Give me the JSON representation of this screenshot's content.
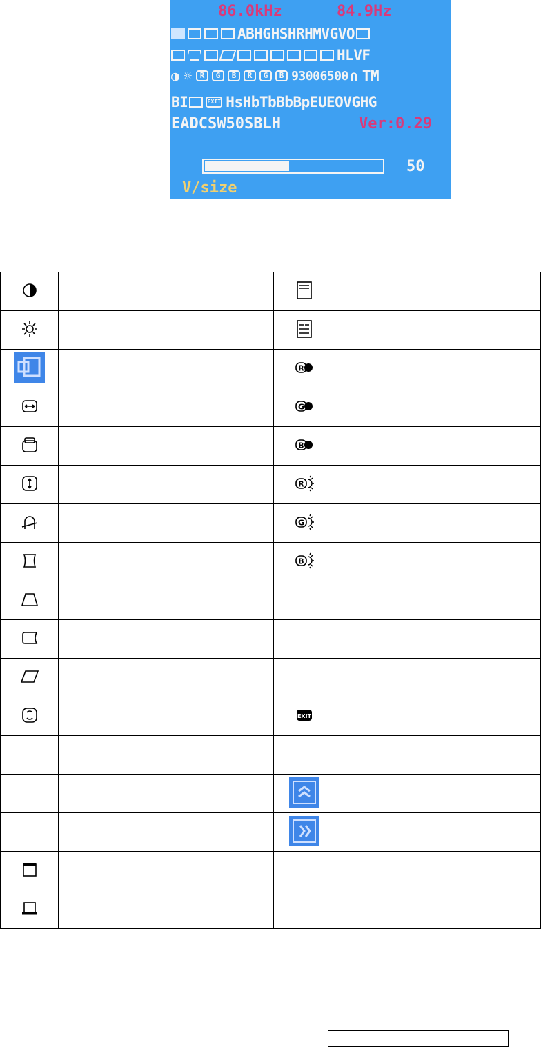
{
  "osd": {
    "h_freq": "86.0kHz",
    "v_freq": "84.9Hz",
    "line1_text": "ABHGHSHRHMVGVO",
    "line2_text": "HLVF",
    "line3_text": "93006500",
    "line3_tail": "TM",
    "line4_start": "BI",
    "line4_text": "HsHbTbBbBpEUEOVGHG",
    "line5_text": "EADCSW50SBLH",
    "version": "Ver:0.29",
    "progress_value": "50",
    "progress_fraction": 0.5,
    "item_label": "V/size",
    "background_color": "#3ea0f2",
    "accent_color": "#d93a7a",
    "label_color": "#f0d070"
  },
  "legend": {
    "rows": [
      {
        "left_icon": "contrast-icon",
        "right_icon": "menu-lines-icon"
      },
      {
        "left_icon": "brightness-icon",
        "right_icon": "adjust-lines-icon"
      },
      {
        "left_icon": "position-icon",
        "right_icon": "red-gain-icon"
      },
      {
        "left_icon": "h-size-icon",
        "right_icon": "green-gain-icon"
      },
      {
        "left_icon": "h-position-icon",
        "right_icon": "blue-gain-icon"
      },
      {
        "left_icon": "v-size-icon",
        "right_icon": "red-bias-icon"
      },
      {
        "left_icon": "moire-icon",
        "right_icon": "green-bias-icon"
      },
      {
        "left_icon": "pincushion-icon",
        "right_icon": "blue-bias-icon"
      },
      {
        "left_icon": "trapezoid-icon",
        "right_icon": ""
      },
      {
        "left_icon": "pin-balance-icon",
        "right_icon": ""
      },
      {
        "left_icon": "parallelogram-icon",
        "right_icon": ""
      },
      {
        "left_icon": "rotation-icon",
        "right_icon": "exit-icon"
      },
      {
        "left_icon": "",
        "right_icon": ""
      },
      {
        "left_icon": "",
        "right_icon": "page-up-icon"
      },
      {
        "left_icon": "",
        "right_icon": "next-page-icon"
      },
      {
        "left_icon": "top-corner-icon",
        "right_icon": ""
      },
      {
        "left_icon": "bottom-corner-icon",
        "right_icon": ""
      }
    ]
  },
  "exit_text": "EXIT",
  "r_letter": "R",
  "g_letter": "G",
  "b_letter": "B"
}
